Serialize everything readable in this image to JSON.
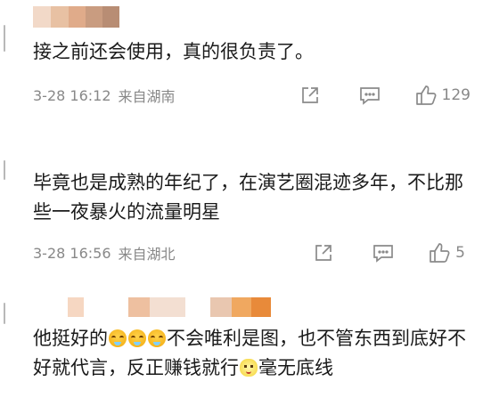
{
  "comments": [
    {
      "text": "接之前还会使用，真的很负责了。",
      "time": "3-28 16:12",
      "location": "来自湖南",
      "likes": "129",
      "name_blur_colors": [
        "#f2d9c8",
        "#e8c1a3",
        "#e0ab8a",
        "#c99c80",
        "#b88d74"
      ]
    },
    {
      "text": "毕竟也是成熟的年纪了，在演艺圈混迹多年，不比那些一夜暴火的流量明星",
      "time": "3-28 16:56",
      "location": "来自湖北",
      "likes": "5",
      "name_blur_colors": [
        "#e7e7e7",
        "#dcdcdc",
        "#e4e4e4"
      ]
    },
    {
      "text_part1": "他挺好的",
      "text_part2": "不会唯利是图，也不管东西到底好不好就代言，反正赚钱就行",
      "text_part3": "毫无底线",
      "emoji_crying": "crying-face-emoji",
      "emoji_cat": "cat-face-emoji",
      "name_blur_colors": [
        "#f6d7c2",
        "#eec0a0",
        "#f3dfd2",
        "#e9c7b0",
        "#f0a860",
        "#e88a3a"
      ]
    }
  ],
  "icons": {
    "share": "share-icon",
    "comment": "comment-icon",
    "like": "thumbs-up-icon"
  }
}
